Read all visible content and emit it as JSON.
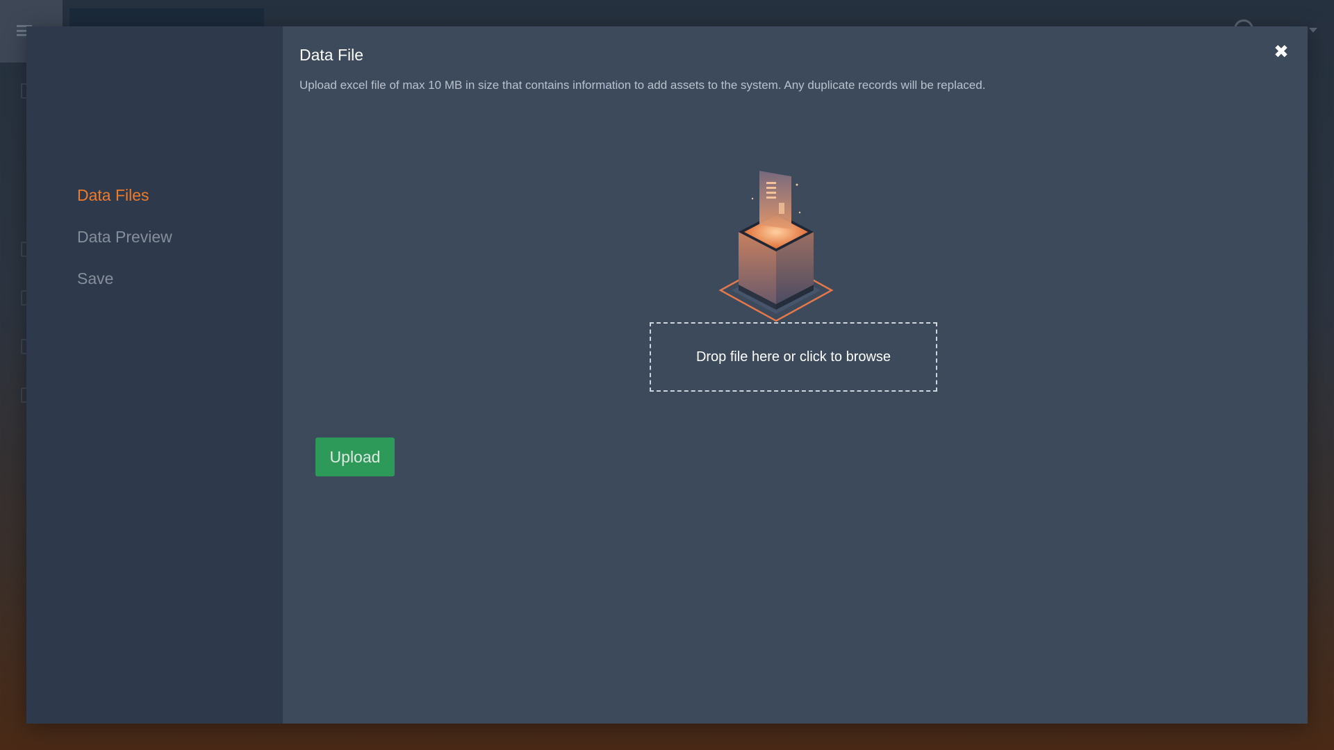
{
  "modal": {
    "title": "Data File",
    "description": "Upload excel file of max 10 MB in size that contains information to add assets to the system. Any duplicate records will be replaced.",
    "close_icon": "close-icon",
    "steps": [
      {
        "label": "Data Files",
        "active": true
      },
      {
        "label": "Data Preview",
        "active": false
      },
      {
        "label": "Save",
        "active": false
      }
    ],
    "dropzone_label": "Drop file here or click to browse",
    "upload_label": "Upload",
    "illustration_icon": "upload-box-icon"
  },
  "colors": {
    "accent": "#ee7b2c",
    "upload_button": "#2e9a5a",
    "modal_background": "#3c4a5c",
    "modal_sidebar": "#2e3a4b"
  }
}
